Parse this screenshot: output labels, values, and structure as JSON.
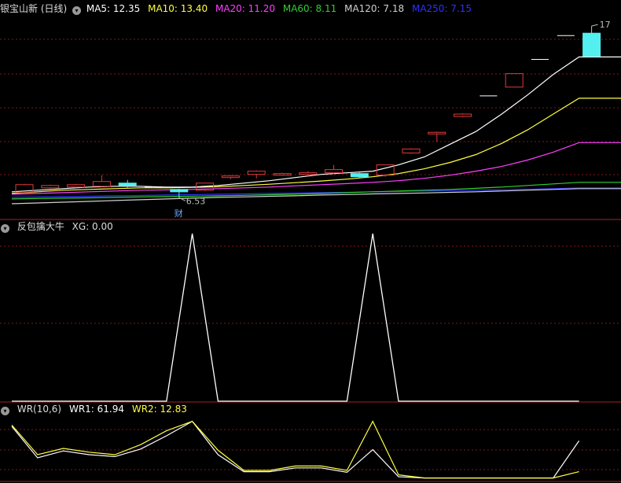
{
  "colors": {
    "background": "#000000",
    "grid": "#7a1a1a",
    "separator": "#a52020",
    "candle_up": "#e03a3a",
    "candle_down": "#54f0f0",
    "ma5": "#ffffff",
    "ma10": "#ffff40",
    "ma20": "#ff40ff",
    "ma60": "#30d030",
    "ma120": "#c8c8c8",
    "ma250": "#2020ff",
    "wr1": "#ffffff",
    "wr2": "#ffff40"
  },
  "price_panel": {
    "title": "银宝山新 (日线)",
    "icon": "chevron-down-icon",
    "indicators": [
      {
        "label": "MA5: 12.35",
        "color": "#ffffff"
      },
      {
        "label": "MA10: 13.40",
        "color": "#ffff40"
      },
      {
        "label": "MA20: 11.20",
        "color": "#ff40ff"
      },
      {
        "label": "MA60: 8.11",
        "color": "#30d030"
      },
      {
        "label": "MA120: 7.18",
        "color": "#d0d0d0"
      },
      {
        "label": "MA250: 7.15",
        "color": "#3030ff"
      }
    ],
    "low_marker": "6.53",
    "high_marker": "17",
    "event_badge": "财"
  },
  "signal_panel": {
    "title": "反包擒大牛",
    "value_label": "XG: 0.00"
  },
  "wr_panel": {
    "title": "WR(10,6)",
    "wr1_label": "WR1: 61.94",
    "wr2_label": "WR2: 12.83"
  },
  "chart_data": [
    {
      "type": "candlestick",
      "title": "银宝山新 (日线)",
      "ylim": [
        6.0,
        18.0
      ],
      "candles": [
        {
          "o": 6.85,
          "c": 7.35,
          "h": 7.4,
          "l": 6.85
        },
        {
          "o": 7.15,
          "c": 7.3,
          "h": 7.35,
          "l": 7.1
        },
        {
          "o": 7.2,
          "c": 7.35,
          "h": 7.4,
          "l": 7.15
        },
        {
          "o": 7.25,
          "c": 7.55,
          "h": 7.95,
          "l": 7.2
        },
        {
          "o": 7.45,
          "c": 7.3,
          "h": 7.65,
          "l": 7.15
        },
        {
          "o": 7.2,
          "c": 7.2,
          "h": 7.25,
          "l": 7.15
        },
        {
          "o": 7.05,
          "c": 6.9,
          "h": 7.1,
          "l": 6.53
        },
        {
          "o": 7.0,
          "c": 7.45,
          "h": 7.45,
          "l": 6.95
        },
        {
          "o": 7.8,
          "c": 7.9,
          "h": 7.95,
          "l": 7.7
        },
        {
          "o": 8.0,
          "c": 8.2,
          "h": 8.25,
          "l": 7.75
        },
        {
          "o": 7.95,
          "c": 8.05,
          "h": 8.1,
          "l": 7.9
        },
        {
          "o": 8.0,
          "c": 8.1,
          "h": 8.2,
          "l": 7.85
        },
        {
          "o": 8.1,
          "c": 8.3,
          "h": 8.6,
          "l": 8.0
        },
        {
          "o": 8.05,
          "c": 7.85,
          "h": 8.1,
          "l": 7.8
        },
        {
          "o": 7.95,
          "c": 8.6,
          "h": 8.6,
          "l": 7.85
        },
        {
          "o": 9.35,
          "c": 9.6,
          "h": 9.65,
          "l": 9.3
        },
        {
          "o": 10.55,
          "c": 10.65,
          "h": 10.7,
          "l": 10.05
        },
        {
          "o": 11.65,
          "c": 11.8,
          "h": 11.85,
          "l": 11.6
        },
        {
          "o": 12.95,
          "c": 12.95,
          "h": 12.95,
          "l": 12.95
        },
        {
          "o": 13.5,
          "c": 14.35,
          "h": 14.35,
          "l": 13.5
        },
        {
          "o": 15.25,
          "c": 15.25,
          "h": 15.25,
          "l": 15.25
        },
        {
          "o": 16.75,
          "c": 16.75,
          "h": 16.75,
          "l": 16.75
        },
        {
          "o": 16.9,
          "c": 15.45,
          "h": 17.35,
          "l": 15.45
        }
      ],
      "series": [
        {
          "name": "MA5",
          "color": "#ffffff",
          "values": [
            6.9,
            7.0,
            7.1,
            7.2,
            7.25,
            7.25,
            7.2,
            7.2,
            7.3,
            7.45,
            7.6,
            7.8,
            8.0,
            8.1,
            8.2,
            8.6,
            9.1,
            9.9,
            10.7,
            11.8,
            13.0,
            14.3,
            15.4
          ]
        },
        {
          "name": "MA10",
          "color": "#ffff40",
          "values": [
            6.8,
            6.9,
            7.0,
            7.05,
            7.1,
            7.15,
            7.15,
            7.18,
            7.22,
            7.3,
            7.38,
            7.48,
            7.58,
            7.7,
            7.85,
            8.05,
            8.35,
            8.75,
            9.25,
            9.95,
            10.8,
            11.8,
            12.8
          ]
        },
        {
          "name": "MA20",
          "color": "#ff40ff",
          "values": [
            6.75,
            6.8,
            6.85,
            6.9,
            6.95,
            7.0,
            7.02,
            7.05,
            7.1,
            7.15,
            7.2,
            7.28,
            7.35,
            7.42,
            7.5,
            7.6,
            7.75,
            7.95,
            8.2,
            8.5,
            8.9,
            9.4,
            10.0
          ]
        },
        {
          "name": "MA60",
          "color": "#30d030",
          "values": [
            6.45,
            6.48,
            6.5,
            6.52,
            6.55,
            6.58,
            6.6,
            6.62,
            6.65,
            6.68,
            6.72,
            6.75,
            6.8,
            6.85,
            6.9,
            6.95,
            7.0,
            7.05,
            7.12,
            7.2,
            7.3,
            7.4,
            7.5
          ]
        },
        {
          "name": "MA120",
          "color": "#d0d0d0",
          "values": [
            6.15,
            6.2,
            6.25,
            6.3,
            6.35,
            6.4,
            6.45,
            6.5,
            6.55,
            6.58,
            6.62,
            6.65,
            6.7,
            6.73,
            6.77,
            6.8,
            6.83,
            6.87,
            6.9,
            6.95,
            7.0,
            7.05,
            7.1
          ]
        },
        {
          "name": "MA250",
          "color": "#3030ff",
          "values": [
            6.55,
            6.57,
            6.6,
            6.62,
            6.65,
            6.67,
            6.7,
            6.72,
            6.75,
            6.77,
            6.8,
            6.82,
            6.85,
            6.87,
            6.9,
            6.92,
            6.95,
            6.98,
            7.0,
            7.03,
            7.06,
            7.1,
            7.15
          ]
        }
      ]
    },
    {
      "type": "line",
      "title": "反包擒大牛",
      "ylim": [
        0,
        1
      ],
      "series": [
        {
          "name": "XG",
          "color": "#ffffff",
          "values": [
            0,
            0,
            0,
            0,
            0,
            0,
            0,
            1,
            0,
            0,
            0,
            0,
            0,
            0,
            1,
            0,
            0,
            0,
            0,
            0,
            0,
            0,
            0
          ]
        }
      ]
    },
    {
      "type": "line",
      "title": "WR(10,6)",
      "ylim": [
        0,
        100
      ],
      "series": [
        {
          "name": "WR1",
          "color": "#ffffff",
          "values": [
            85,
            35,
            46,
            40,
            37,
            49,
            70,
            93,
            40,
            13,
            13,
            19,
            19,
            12,
            48,
            5,
            3,
            3,
            3,
            3,
            3,
            3,
            62
          ]
        },
        {
          "name": "WR2",
          "color": "#ffff40",
          "values": [
            87,
            40,
            50,
            44,
            40,
            56,
            78,
            93,
            47,
            15,
            15,
            22,
            22,
            15,
            93,
            8,
            3,
            3,
            3,
            3,
            3,
            3,
            13
          ]
        }
      ]
    }
  ]
}
